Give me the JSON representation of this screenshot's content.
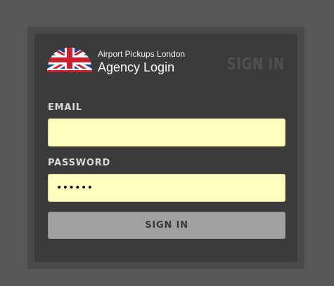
{
  "brand": {
    "company_name": "Airport Pickups London",
    "portal_title": "Agency Login",
    "logo_icon": "union-jack-flag-icon",
    "colors": {
      "flag_blue": "#1f3f8f",
      "flag_red": "#cf1f2c",
      "flag_white": "#ffffff"
    }
  },
  "form": {
    "heading": "SIGN IN",
    "email": {
      "label": "EMAIL",
      "value": ""
    },
    "password": {
      "label": "PASSWORD",
      "value": "••••••"
    },
    "submit_label": "SIGN IN"
  },
  "colors": {
    "page_background": "#575757",
    "panel_background": "#3b3b3b",
    "input_background": "#ffffc0",
    "button_background": "#a0a0a0"
  }
}
